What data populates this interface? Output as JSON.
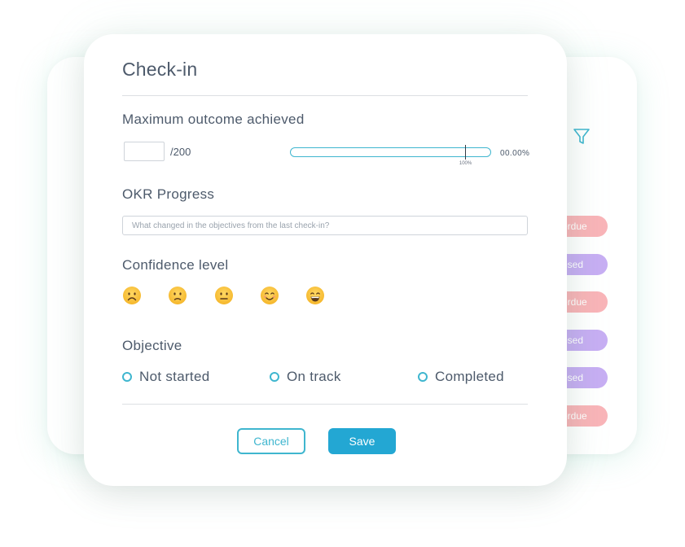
{
  "modal": {
    "title": "Check-in",
    "outcome": {
      "label": "Maximum outcome achieved",
      "input_value": "",
      "max_text": "/200",
      "progress_tick_label": "100%",
      "progress_percent_text": "00.00%",
      "marker_fraction": 0.87
    },
    "okr": {
      "label": "OKR Progress",
      "placeholder": "What changed in the objectives from the last check-in?"
    },
    "confidence": {
      "label": "Confidence level",
      "options": [
        "very-sad-face-icon",
        "sad-face-icon",
        "neutral-face-icon",
        "happy-face-icon",
        "very-happy-face-icon"
      ]
    },
    "objective": {
      "label": "Objective",
      "options": [
        "Not started",
        "On track",
        "Completed"
      ]
    },
    "buttons": {
      "cancel": "Cancel",
      "save": "Save"
    }
  },
  "background": {
    "status_pills": [
      "erdue",
      "osed",
      "erdue",
      "osed",
      "osed",
      "erdue"
    ]
  },
  "colors": {
    "accent": "#3fb6cf",
    "save_button": "#23a7d3",
    "overdue_pill": "#f9b4b8",
    "closed_pill": "#c7aef3",
    "text": "#4d5a6b"
  }
}
